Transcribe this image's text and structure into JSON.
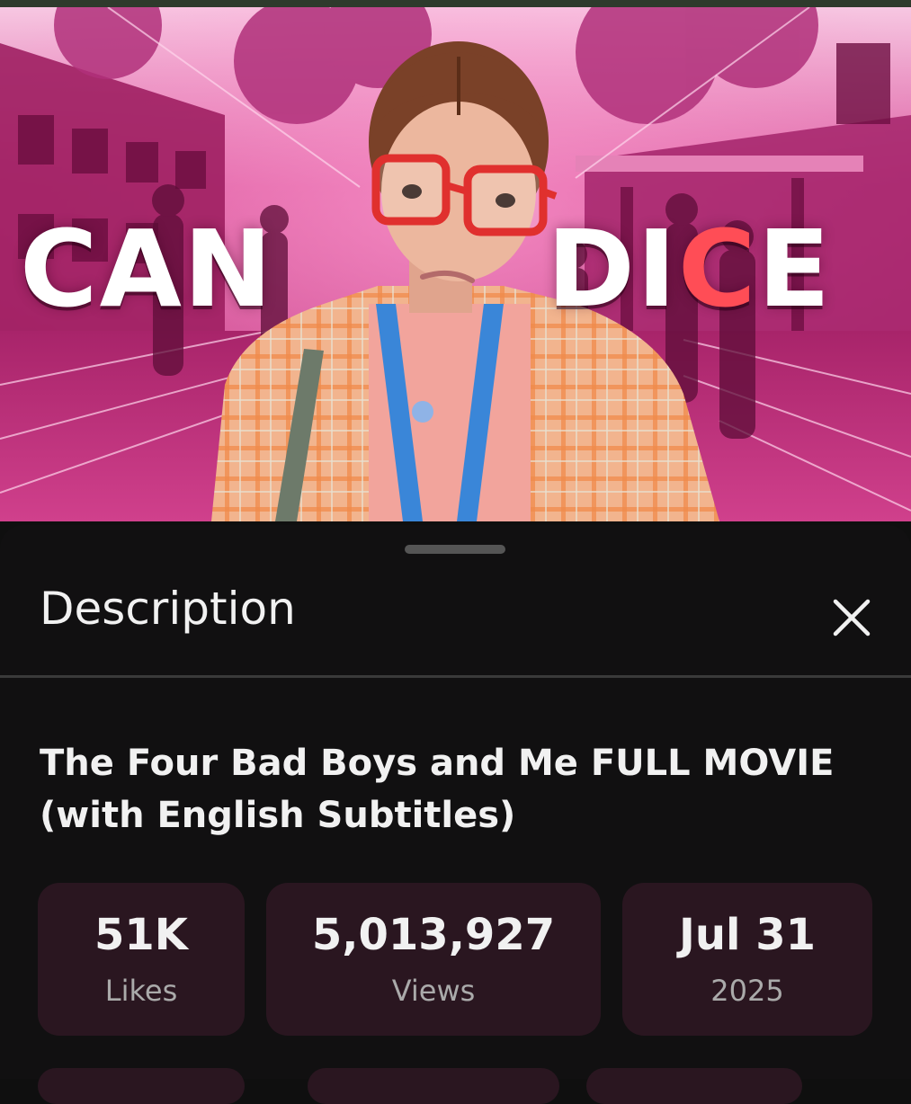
{
  "video": {
    "overlay_left": "CAN",
    "overlay_right_prefix": "DI",
    "overlay_right_accent": "C",
    "overlay_right_suffix": "E",
    "progress_fraction": 0.05,
    "accent_color": "#ff4d56",
    "tint_color": "#c2327f"
  },
  "description_panel": {
    "header_title": "Description",
    "close_icon": "close-icon",
    "video_title": "The Four Bad Boys and Me FULL MOVIE (with English Subtitles)",
    "stats": {
      "likes": {
        "value": "51K",
        "label": "Likes"
      },
      "views": {
        "value": "5,013,927",
        "label": "Views"
      },
      "date": {
        "value": "Jul 31",
        "label": "2025"
      }
    },
    "card_color": "#2a1620"
  }
}
